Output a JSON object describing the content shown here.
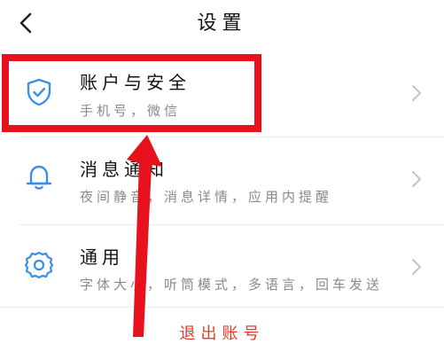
{
  "header": {
    "title": "设置",
    "back_icon": "chevron-left-icon"
  },
  "settings": [
    {
      "label": "账户与安全",
      "subtitle": "手机号，微信",
      "icon": "shield-check-icon"
    },
    {
      "label": "消息通知",
      "subtitle": "夜间静音，消息详情，应用内提醒",
      "icon": "bell-icon"
    },
    {
      "label": "通用",
      "subtitle": "字体大小，听筒模式，多语言，回车发送",
      "icon": "gear-icon"
    }
  ],
  "logout_label": "退出账号",
  "colors": {
    "accent_blue": "#3d8fe6",
    "highlight_red": "#e8121e",
    "logout_red": "#e63a2b"
  }
}
